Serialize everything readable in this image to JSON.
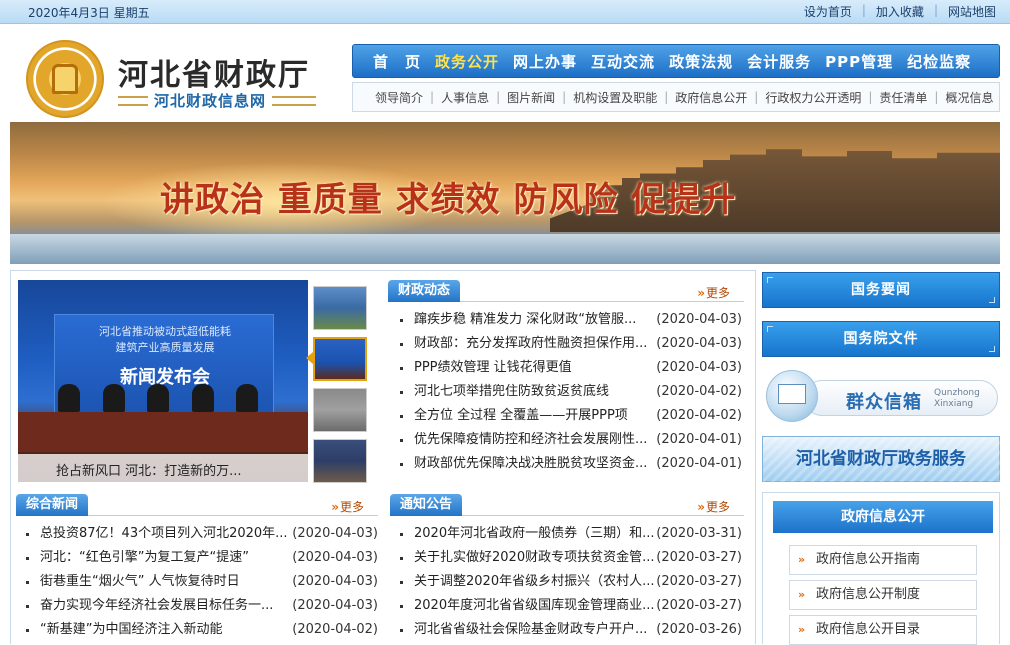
{
  "topbar": {
    "date": "2020年4月3日  星期五",
    "links": [
      "设为首页",
      "加入收藏",
      "网站地图"
    ]
  },
  "header": {
    "title": "河北省财政厅",
    "subtitle": "河北财政信息网"
  },
  "main_nav": [
    "首　页",
    "政务公开",
    "网上办事",
    "互动交流",
    "政策法规",
    "会计服务",
    "PPP管理",
    "纪检监察"
  ],
  "sub_nav": [
    "领导简介",
    "人事信息",
    "图片新闻",
    "机构设置及职能",
    "政府信息公开",
    "行政权力公开透明",
    "责任清单",
    "概况信息"
  ],
  "banner": {
    "slogan": "讲政治  重质量  求绩效  防风险  促提升"
  },
  "photo_news": {
    "board_line1": "河北省推动被动式超低能耗",
    "board_line2": "建筑产业高质量发展",
    "board_title": "新闻发布会",
    "caption": "抢占新风口 河北：打造新的万..."
  },
  "finance_news": {
    "title": "财政动态",
    "more": "更多",
    "items": [
      {
        "title": "蹿疾步稳 精准发力 深化财政“放管服...",
        "date": "(2020-04-03)"
      },
      {
        "title": "财政部：充分发挥政府性融资担保作用...",
        "date": "(2020-04-03)"
      },
      {
        "title": "PPP绩效管理 让钱花得更值",
        "date": "(2020-04-03)"
      },
      {
        "title": "河北七项举措兜住防致贫返贫底线",
        "date": "(2020-04-02)"
      },
      {
        "title": "全方位 全过程 全覆盖——开展PPP项",
        "date": "(2020-04-02)"
      },
      {
        "title": "优先保障疫情防控和经济社会发展刚性...",
        "date": "(2020-04-01)"
      },
      {
        "title": "财政部优先保障决战决胜脱贫攻坚资金...",
        "date": "(2020-04-01)"
      }
    ]
  },
  "general_news": {
    "title": "综合新闻",
    "more": "更多",
    "items": [
      {
        "title": "总投资87亿！43个项目列入河北2020年...",
        "date": "(2020-04-03)"
      },
      {
        "title": "河北：“红色引擎”为复工复产“提速”",
        "date": "(2020-04-03)"
      },
      {
        "title": "街巷重生“烟火气” 人气恢复待时日",
        "date": "(2020-04-03)"
      },
      {
        "title": "奋力实现今年经济社会发展目标任务一...",
        "date": "(2020-04-03)"
      },
      {
        "title": "“新基建”为中国经济注入新动能",
        "date": "(2020-04-02)"
      }
    ]
  },
  "notices": {
    "title": "通知公告",
    "more": "更多",
    "items": [
      {
        "title": "2020年河北省政府一般债券（三期）和...",
        "date": "(2020-03-31)"
      },
      {
        "title": "关于扎实做好2020财政专项扶贫资金管...",
        "date": "(2020-03-27)"
      },
      {
        "title": "关于调整2020年省级乡村振兴（农村人...",
        "date": "(2020-03-27)"
      },
      {
        "title": "2020年度河北省省级国库现金管理商业...",
        "date": "(2020-03-27)"
      },
      {
        "title": "河北省省级社会保险基金财政专户开户...",
        "date": "(2020-03-26)"
      }
    ]
  },
  "right": {
    "state_affairs": "国务要闻",
    "state_council_docs": "国务院文件",
    "mailbox_cn": "群众信箱",
    "mailbox_en1": "Qunzhong",
    "mailbox_en2": "Xinxiang",
    "gov_service": "河北省财政厅政务服务",
    "gov_open_title": "政府信息公开",
    "gov_open_links": [
      "政府信息公开指南",
      "政府信息公开制度",
      "政府信息公开目录"
    ]
  },
  "colors": {
    "nav_blue": "#1d6fc7",
    "nav_active": "#ffe24a",
    "slogan_red": "#b8321a",
    "more_orange": "#e06a10"
  }
}
